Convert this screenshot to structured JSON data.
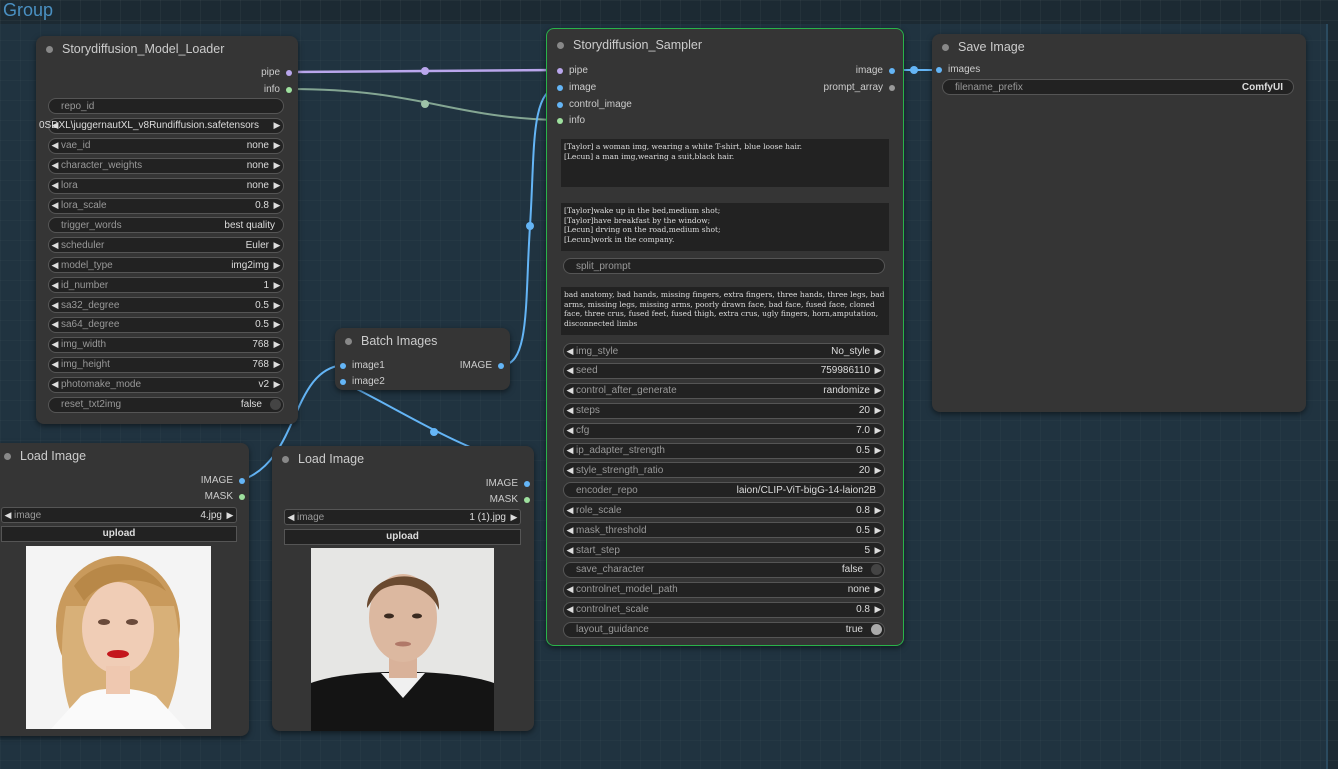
{
  "group": {
    "title": "Group"
  },
  "model_loader": {
    "title": "Storydiffusion_Model_Loader",
    "outputs": [
      "pipe",
      "info"
    ],
    "widgets": [
      {
        "label": "repo_id",
        "value": "",
        "type": "text"
      },
      {
        "label": "",
        "value": "0SDXL\\juggernautXL_v8Rundiffusion.safetensors",
        "type": "combo"
      },
      {
        "label": "vae_id",
        "value": "none",
        "type": "combo"
      },
      {
        "label": "character_weights",
        "value": "none",
        "type": "combo"
      },
      {
        "label": "lora",
        "value": "none",
        "type": "combo"
      },
      {
        "label": "lora_scale",
        "value": "0.8",
        "type": "combo"
      },
      {
        "label": "trigger_words",
        "value": "best quality",
        "type": "text"
      },
      {
        "label": "scheduler",
        "value": "Euler",
        "type": "combo"
      },
      {
        "label": "model_type",
        "value": "img2img",
        "type": "combo"
      },
      {
        "label": "id_number",
        "value": "1",
        "type": "combo"
      },
      {
        "label": "sa32_degree",
        "value": "0.5",
        "type": "combo"
      },
      {
        "label": "sa64_degree",
        "value": "0.5",
        "type": "combo"
      },
      {
        "label": "img_width",
        "value": "768",
        "type": "combo"
      },
      {
        "label": "img_height",
        "value": "768",
        "type": "combo"
      },
      {
        "label": "photomake_mode",
        "value": "v2",
        "type": "combo"
      },
      {
        "label": "reset_txt2img",
        "value": "false",
        "type": "toggle"
      }
    ]
  },
  "sampler": {
    "title": "Storydiffusion_Sampler",
    "inputs": [
      "pipe",
      "image",
      "control_image",
      "info"
    ],
    "outputs": [
      "image",
      "prompt_array"
    ],
    "character_prompt": "[Taylor] a woman img, wearing a white T-shirt, blue loose hair.\n[Lecun] a man img,wearing a suit,black hair.",
    "scene_prompt": "[Taylor]wake up in the bed,medium shot;\n[Taylor]have breakfast by the window;\n[Lecun] drving on the road,medium shot;\n[Lecun]work in the company.",
    "split_prompt": "split_prompt",
    "negative_prompt": "bad anatomy, bad hands, missing fingers, extra fingers, three hands, three legs, bad arms, missing legs, missing arms, poorly drawn face, bad face, fused face, cloned face, three crus, fused feet, fused thigh, extra crus, ugly fingers, horn,amputation, disconnected limbs",
    "widgets": [
      {
        "label": "img_style",
        "value": "No_style",
        "type": "combo"
      },
      {
        "label": "seed",
        "value": "759986110",
        "type": "combo"
      },
      {
        "label": "control_after_generate",
        "value": "randomize",
        "type": "combo"
      },
      {
        "label": "steps",
        "value": "20",
        "type": "combo"
      },
      {
        "label": "cfg",
        "value": "7.0",
        "type": "combo"
      },
      {
        "label": "ip_adapter_strength",
        "value": "0.5",
        "type": "combo"
      },
      {
        "label": "style_strength_ratio",
        "value": "20",
        "type": "combo"
      },
      {
        "label": "encoder_repo",
        "value": "laion/CLIP-ViT-bigG-14-laion2B",
        "type": "text"
      },
      {
        "label": "role_scale",
        "value": "0.8",
        "type": "combo"
      },
      {
        "label": "mask_threshold",
        "value": "0.5",
        "type": "combo"
      },
      {
        "label": "start_step",
        "value": "5",
        "type": "combo"
      },
      {
        "label": "save_character",
        "value": "false",
        "type": "toggle"
      },
      {
        "label": "controlnet_model_path",
        "value": "none",
        "type": "combo"
      },
      {
        "label": "controlnet_scale",
        "value": "0.8",
        "type": "combo"
      },
      {
        "label": "layout_guidance",
        "value": "true",
        "type": "toggle_on"
      }
    ]
  },
  "save_image": {
    "title": "Save Image",
    "inputs": [
      "images"
    ],
    "filename_prefix_label": "filename_prefix",
    "filename_prefix_value": "ComfyUI"
  },
  "batch_images": {
    "title": "Batch Images",
    "inputs": [
      "image1",
      "image2"
    ],
    "outputs": [
      "IMAGE"
    ]
  },
  "load_image_1": {
    "title": "Load Image",
    "outputs": [
      "IMAGE",
      "MASK"
    ],
    "image_label": "image",
    "image_value": "4.jpg",
    "upload": "upload"
  },
  "load_image_2": {
    "title": "Load Image",
    "outputs": [
      "IMAGE",
      "MASK"
    ],
    "image_label": "image",
    "image_value": "1 (1).jpg",
    "upload": "upload"
  },
  "colors": {
    "canvas": "#1c2a33",
    "node": "#353535",
    "selected_border": "#29b34a",
    "pipe_link": "#b9a6ec",
    "info_link": "#9ec3a8",
    "image_link": "#64b5f6"
  }
}
